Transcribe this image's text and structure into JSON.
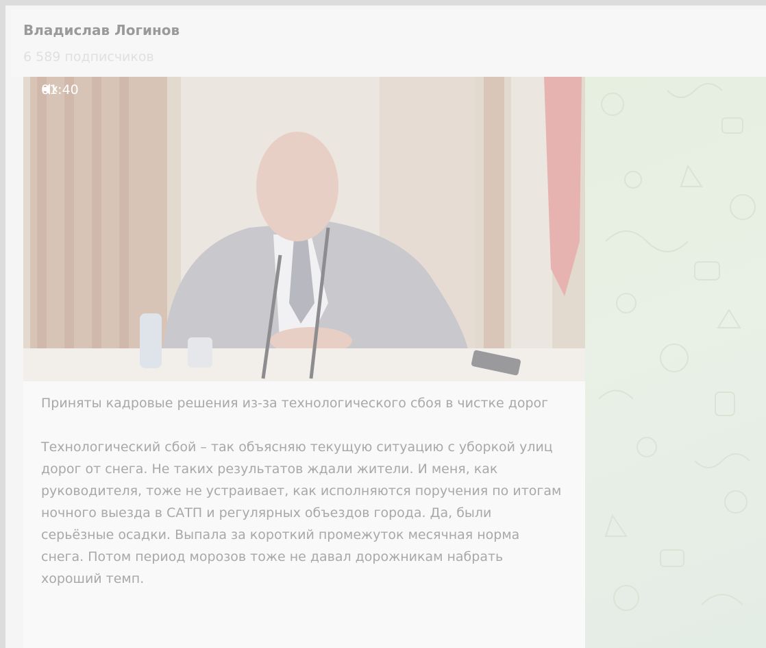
{
  "channel": {
    "name": "Владислав Логинов",
    "subscribers": "6 589 подписчиков"
  },
  "video": {
    "duration": "01:40",
    "sound_icon": "muted-speaker-icon"
  },
  "post": {
    "headline": "Приняты кадровые решения из-за технологического сбоя в чистке дорог",
    "body": "Технологический сбой – так объясняю текущую ситуацию с уборкой улиц дорог от снега. Не таких результатов ждали жители. И меня, как руководителя, тоже не устраивает, как исполняются поручения по итогам ночного выезда в САТП и регулярных объездов города. Да, были серьёзные осадки. Выпала за короткий промежуток месячная норма снега. Потом период морозов тоже не давал дорожникам набрать хороший темп."
  },
  "colors": {
    "page_overlay": "#f5f5f5",
    "wallpaper": "#e6efe0",
    "text_muted": "#a8a8a8"
  }
}
